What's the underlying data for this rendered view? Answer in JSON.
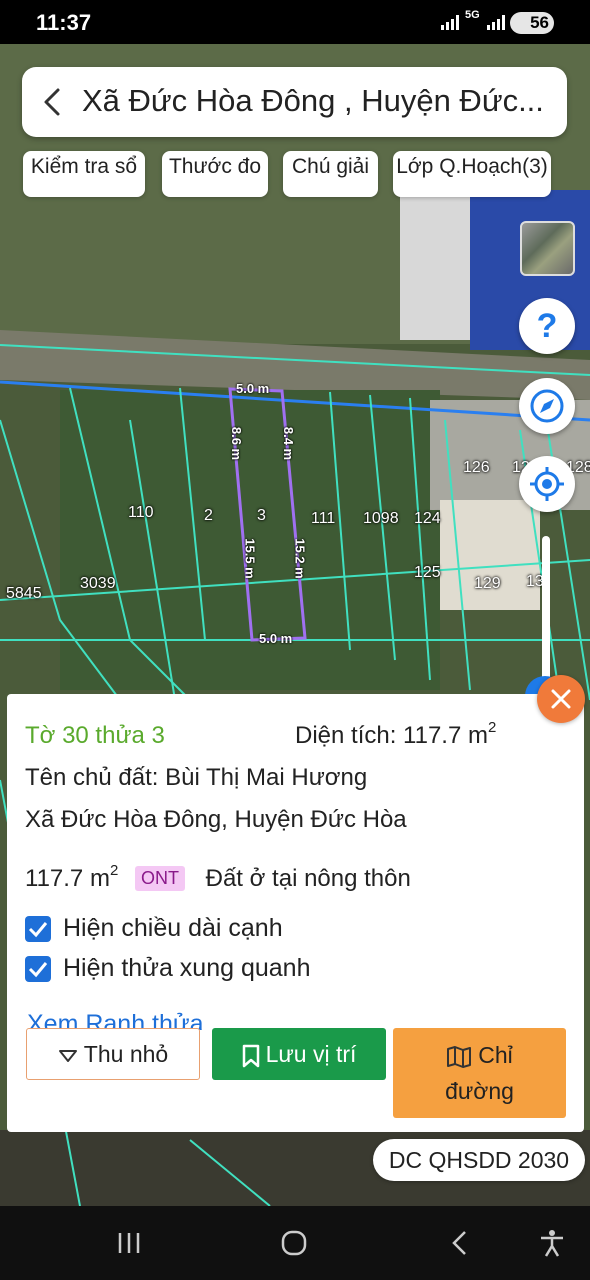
{
  "status_bar": {
    "time": "11:37",
    "network": "5G",
    "battery": "56"
  },
  "header": {
    "back_icon": "chevron-left-icon",
    "title": "Xã Đức Hòa Đông , Huyện Đức..."
  },
  "toolbar": {
    "chips": [
      {
        "label": "Kiểm tra sổ"
      },
      {
        "label": "Thước đo"
      },
      {
        "label": "Chú giải"
      },
      {
        "label": "Lớp Q.Hoạch(3)"
      }
    ]
  },
  "map": {
    "parcel_numbers": [
      "126",
      "12",
      "128",
      "110",
      "2",
      "3",
      "111",
      "1098",
      "124",
      "125",
      "129",
      "13",
      "5845",
      "3039"
    ],
    "dimensions": [
      "5.0 m",
      "8.6 m",
      "8.4 m",
      "15.5 m",
      "15.2 m",
      "5.0 m"
    ],
    "colors": {
      "boundary": "#40e0c0",
      "selected": "#a070f0",
      "road": "#2a7ff0"
    }
  },
  "controls": {
    "layer_icon": "satellite-layer-icon",
    "help_icon": "help-icon",
    "compass_icon": "compass-icon",
    "locate_icon": "my-location-icon",
    "zoom_slider": 0.05
  },
  "info_card": {
    "sheet": "Tờ 30 thửa 3",
    "area_label": "Diện tích: 117.7 m",
    "area_sup": "2",
    "owner": "Tên chủ đất: Bùi Thị Mai Hương",
    "address": "Xã Đức Hòa Đông, Huyện Đức Hòa",
    "land_area": "117.7 m",
    "land_area_sup": "2",
    "land_code": "ONT",
    "land_type": "Đất ở tại nông thôn",
    "checkboxes": [
      {
        "label": "Hiện chiều dài cạnh",
        "checked": true
      },
      {
        "label": "Hiện thửa xung quanh",
        "checked": true
      }
    ],
    "link": "Xem Ranh thửa",
    "buttons": {
      "shrink": "Thu nhỏ",
      "save": "Lưu vị trí",
      "route_line1": "Chỉ",
      "route_line2": "đường"
    },
    "accent": "#5aaa2d"
  },
  "plan_label": "DC QHSDD 2030",
  "nav": {
    "recents_icon": "recents-icon",
    "home_icon": "home-icon",
    "back_icon": "back-icon",
    "accessibility_icon": "accessibility-icon"
  }
}
